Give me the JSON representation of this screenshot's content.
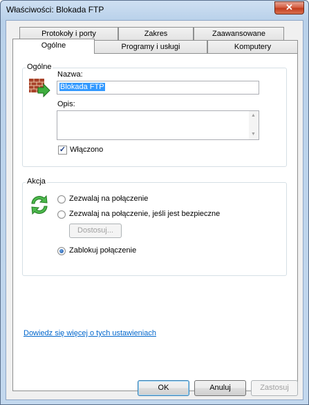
{
  "window": {
    "title": "Właściwości: Blokada FTP",
    "close_glyph": "✕"
  },
  "tabs": {
    "row1": [
      "Protokoły i porty",
      "Zakres",
      "Zaawansowane"
    ],
    "row2": [
      "Ogólne",
      "Programy i usługi",
      "Komputery"
    ],
    "active": "Ogólne"
  },
  "general": {
    "group_title": "Ogólne",
    "name_label": "Nazwa:",
    "name_value": "Blokada FTP",
    "description_label": "Opis:",
    "description_value": "",
    "enabled_label": "Włączono",
    "enabled_checked": true
  },
  "action": {
    "group_title": "Akcja",
    "options": [
      {
        "label": "Zezwalaj na połączenie",
        "selected": false
      },
      {
        "label": "Zezwalaj na połączenie, jeśli jest bezpieczne",
        "selected": false
      },
      {
        "label": "Zablokuj połączenie",
        "selected": true
      }
    ],
    "customize_label": "Dostosuj..."
  },
  "learn_more_link": "Dowiedz się więcej o tych ustawieniach",
  "buttons": {
    "ok": "OK",
    "cancel": "Anuluj",
    "apply": "Zastosuj"
  }
}
